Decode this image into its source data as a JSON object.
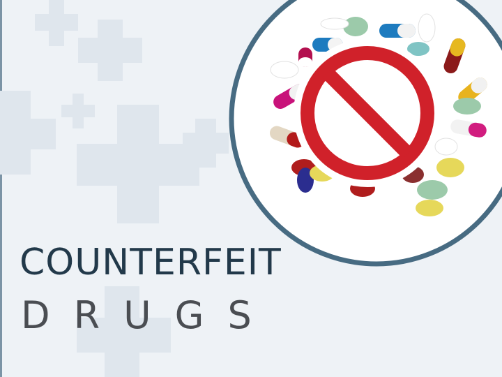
{
  "title": {
    "line1": "COUNTERFEIT",
    "line2": "DRUGS"
  },
  "colors": {
    "background": "#eef2f6",
    "circle_ring": "#476b82",
    "prohibition": "#d0212a",
    "title_dark": "#22394a",
    "title_gray": "#4a4d52"
  },
  "icons": [
    "medical-cross-icon",
    "pill-icon",
    "capsule-icon",
    "prohibition-icon"
  ]
}
